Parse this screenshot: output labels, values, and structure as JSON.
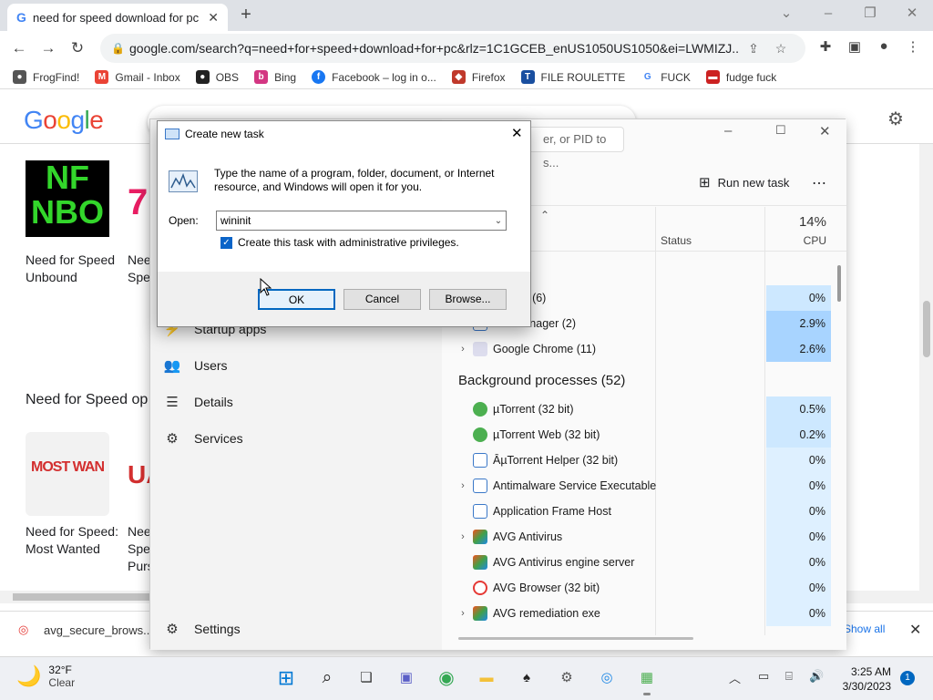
{
  "browser": {
    "tab_title": "need for speed download for pc",
    "tab_favicon": "G",
    "url": "google.com/search?q=need+for+speed+download+for+pc&rlz=1C1GCEB_enUS1050US1050&ei=LWMIZJ...",
    "bookmarks": [
      {
        "label": "FrogFind!",
        "icon": "frog-icon",
        "color": "#555555"
      },
      {
        "label": "Gmail - Inbox",
        "icon": "gmail-icon",
        "color": "#ea4335"
      },
      {
        "label": "OBS",
        "icon": "github-icon",
        "color": "#222222"
      },
      {
        "label": "Bing",
        "icon": "bing-icon",
        "color": "#d33682"
      },
      {
        "label": "Facebook – log in o...",
        "icon": "facebook-icon",
        "color": "#1877f2"
      },
      {
        "label": "Firefox",
        "icon": "firefox-icon",
        "color": "#c0392b"
      },
      {
        "label": "FILE ROULETTE",
        "icon": "file-roulette-icon",
        "color": "#1a4fa0"
      },
      {
        "label": "FUCK",
        "icon": "google-icon",
        "color": "#4285f4"
      },
      {
        "label": "fudge fuck",
        "icon": "flag-icon",
        "color": "#cc2222"
      }
    ]
  },
  "google": {
    "logo": "Google",
    "search_text": "need for speed download for pc",
    "results": [
      {
        "title": "Need for Speed Unbound",
        "art": "NF NBO"
      },
      {
        "title": "Need for Speed: Most Wanted",
        "art": "MOST WAN"
      }
    ],
    "partial_titles": [
      "Nee",
      "Spe",
      "Nee",
      "Spe",
      "Purs"
    ],
    "section_title": "Need for Speed op",
    "download": {
      "file": "avg_secure_brows....",
      "show_all": "Show all"
    }
  },
  "taskmgr": {
    "search_placeholder": "er, or PID to s...",
    "run_new_task": "Run new task",
    "columns": {
      "status": "Status",
      "cpu_pct": "14%",
      "cpu": "CPU"
    },
    "nav": [
      {
        "label": "Startup apps",
        "icon": "startup-icon"
      },
      {
        "label": "Users",
        "icon": "users-icon"
      },
      {
        "label": "Details",
        "icon": "details-icon"
      },
      {
        "label": "Services",
        "icon": "services-icon"
      }
    ],
    "settings_label": "Settings",
    "apps": [
      {
        "name": "ntivirus (6)",
        "cpu": "0%",
        "expand": false
      },
      {
        "name": "ask Manager (2)",
        "cpu": "2.9%",
        "expand": false
      },
      {
        "name": "Google Chrome (11)",
        "cpu": "2.6%",
        "expand": true
      }
    ],
    "bg_header": "Background processes (52)",
    "bg": [
      {
        "name": "µTorrent (32 bit)",
        "cpu": "0.5%",
        "expand": false,
        "icon": "utorrent-icon"
      },
      {
        "name": "µTorrent Web (32 bit)",
        "cpu": "0.2%",
        "expand": false,
        "icon": "utorrent-icon"
      },
      {
        "name": "ÂµTorrent Helper (32 bit)",
        "cpu": "0%",
        "expand": false,
        "icon": "app-window-icon"
      },
      {
        "name": "Antimalware Service Executable",
        "cpu": "0%",
        "expand": true,
        "icon": "app-window-icon"
      },
      {
        "name": "Application Frame Host",
        "cpu": "0%",
        "expand": false,
        "icon": "app-window-icon"
      },
      {
        "name": "AVG Antivirus",
        "cpu": "0%",
        "expand": true,
        "icon": "avg-icon"
      },
      {
        "name": "AVG Antivirus engine server",
        "cpu": "0%",
        "expand": false,
        "icon": "avg-icon"
      },
      {
        "name": "AVG Browser (32 bit)",
        "cpu": "0%",
        "expand": false,
        "icon": "avg-browser-icon"
      },
      {
        "name": "AVG remediation exe",
        "cpu": "0%",
        "expand": true,
        "icon": "avg-icon"
      }
    ]
  },
  "dialog": {
    "title": "Create new task",
    "description": "Type the name of a program, folder, document, or Internet resource, and Windows will open it for you.",
    "open_label": "Open:",
    "open_value": "wininit",
    "admin_label": "Create this task with administrative privileges.",
    "admin_checked": true,
    "ok": "OK",
    "cancel": "Cancel",
    "browse": "Browse..."
  },
  "taskbar": {
    "weather_temp": "32°F",
    "weather_desc": "Clear",
    "time": "3:25 AM",
    "date": "3/30/2023",
    "notification_count": "1"
  }
}
